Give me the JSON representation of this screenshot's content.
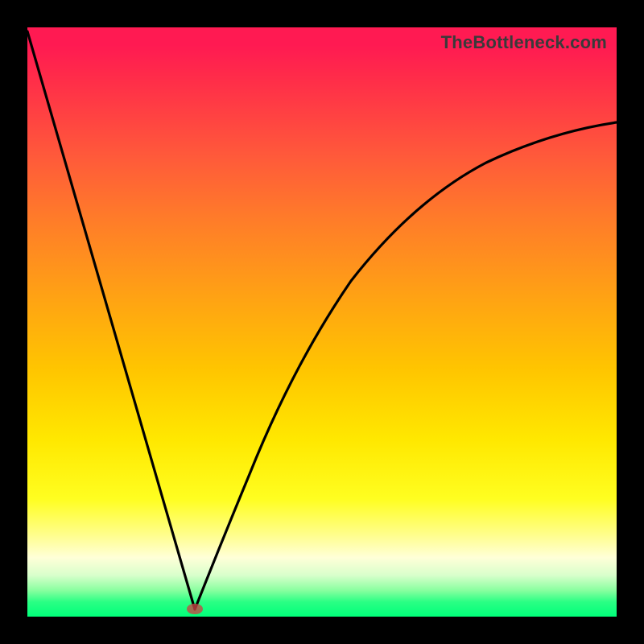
{
  "attribution": "TheBottleneck.com",
  "colors": {
    "frame": "#000000",
    "gradient_top": "#ff1a52",
    "gradient_mid": "#ffe800",
    "gradient_bottom": "#00ff7a",
    "curve": "#000000",
    "marker": "rgba(200,68,68,0.78)"
  },
  "chart_data": {
    "type": "line",
    "title": "",
    "xlabel": "",
    "ylabel": "",
    "xlim": [
      0,
      100
    ],
    "ylim": [
      0,
      100
    ],
    "minimum": {
      "x": 28.5,
      "y": 0
    },
    "series": [
      {
        "name": "left-branch",
        "x": [
          0,
          3,
          6,
          9,
          12,
          15,
          18,
          21,
          24,
          27,
          28.5
        ],
        "values": [
          100,
          88,
          77,
          66,
          56,
          46,
          36,
          27,
          17,
          6,
          0
        ]
      },
      {
        "name": "right-branch",
        "x": [
          28.5,
          30,
          33,
          37,
          42,
          48,
          55,
          63,
          72,
          82,
          92,
          100
        ],
        "values": [
          0,
          8,
          22,
          35,
          46,
          55,
          62,
          68,
          73,
          77.5,
          81,
          83
        ]
      }
    ],
    "annotations": [
      {
        "name": "optimal-marker",
        "x": 28.5,
        "y": 0
      }
    ]
  },
  "layout": {
    "image_size": 800,
    "frame_margin": 34,
    "plot_size": 732
  }
}
